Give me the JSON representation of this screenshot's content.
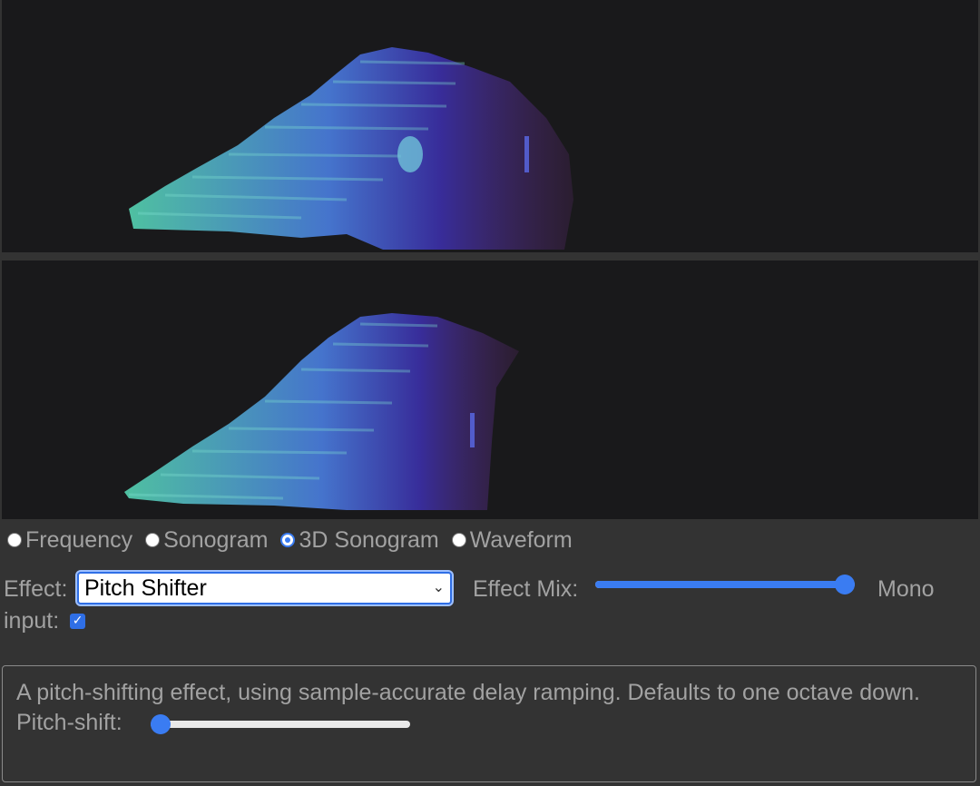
{
  "visualization": {
    "views": [
      "top",
      "bottom"
    ]
  },
  "view_modes": {
    "options": [
      {
        "label": "Frequency",
        "selected": false
      },
      {
        "label": "Sonogram",
        "selected": false
      },
      {
        "label": "3D Sonogram",
        "selected": true
      },
      {
        "label": "Waveform",
        "selected": false
      }
    ]
  },
  "effect": {
    "label": "Effect:",
    "selected": "Pitch Shifter",
    "mix_label": "Effect Mix:",
    "mix_value": 1.0,
    "mono_label": "Mono",
    "input_label": "input:",
    "mono_input_checked": true
  },
  "description": {
    "text": "A pitch-shifting effect, using sample-accurate delay ramping. Defaults to one octave down.",
    "pitch_label": "Pitch-shift:",
    "pitch_value": 0.0
  },
  "colors": {
    "accent": "#3a7cf2",
    "background": "#333333",
    "viz_background": "#19191b"
  }
}
